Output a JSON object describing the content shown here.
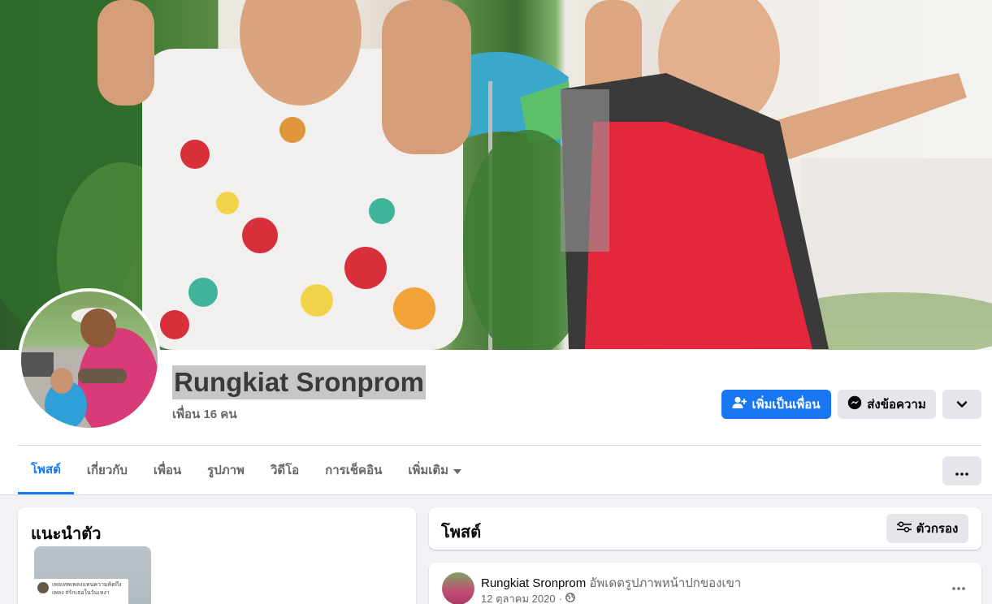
{
  "profile": {
    "name": "Rungkiat Sronprom",
    "friends_count": "เพื่อน 16 คน"
  },
  "actions": {
    "add_friend_label": "เพิ่มเป็นเพื่อน",
    "message_label": "ส่งข้อความ"
  },
  "tabs": [
    {
      "label": "โพสต์",
      "active": true
    },
    {
      "label": "เกี่ยวกับ"
    },
    {
      "label": "เพื่อน"
    },
    {
      "label": "รูปภาพ"
    },
    {
      "label": "วิดีโอ"
    },
    {
      "label": "การเช็คอิน"
    },
    {
      "label": "เพิ่มเติม"
    }
  ],
  "intro": {
    "title": "แนะนำตัว",
    "featured_caption_line1": "เพจเทพเพลงแทนความคิดถึง",
    "featured_caption_line2": "เพลง #รักเธอในวันเหงา"
  },
  "posts_section": {
    "title": "โพสต์",
    "filter_label": "ตัวกรอง"
  },
  "post": {
    "author": "Rungkiat Sronprom",
    "action": "อัพเดตรูปภาพหน้าปกของเขา",
    "date": "12 ตุลาคม 2020",
    "separator": "·"
  },
  "colors": {
    "accent": "#1877f2",
    "page_bg": "#f0f2f5",
    "button_gray": "#e4e6eb",
    "secondary_text": "#65676b"
  },
  "icons": {
    "add_friend": "person-plus-icon",
    "message": "messenger-icon",
    "chevron": "chevron-down-icon",
    "more": "ellipsis-icon",
    "filter": "sliders-icon",
    "privacy": "globe-icon"
  }
}
